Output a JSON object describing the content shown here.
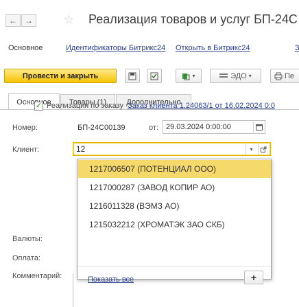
{
  "header": {
    "back_glyph": "←",
    "forward_glyph": "→",
    "favorite_glyph": "☆",
    "title": "Реализация товаров и услуг БП-24С"
  },
  "topnav": {
    "items": [
      "Основное",
      "Идентификаторы Битрикс24",
      "Открыть в Битрикс24",
      "З"
    ]
  },
  "toolbar": {
    "post_close": "Провести и закрыть",
    "edo": "ЭДО",
    "print_partial": "Пе"
  },
  "tabs": [
    "Основное",
    "Товары (1)",
    "Дополнительно"
  ],
  "form": {
    "sale_by_order_label": "Реализация по заказу",
    "order_link": "Заказ клиента 1.24063/1 от 16.02.2024 0:0",
    "number_label": "Номер:",
    "number_value": "БП-24С00139",
    "from_label": "от:",
    "date_value": "29.03.2024  0:00:00",
    "client_label": "Клиент:",
    "client_input": "12",
    "currency_label": "Валюты:",
    "payment_label": "Оплата:",
    "comment_label": "Комментарий:"
  },
  "dropdown": {
    "items": [
      "1217006507 (ПОТЕНЦИАЛ ООО)",
      "1217000287 (ЗАВОД КОПИР АО)",
      "1216011328 (ВЭМЗ АО)",
      "1215032212 (ХРОМАТЭК ЗАО СКБ)"
    ],
    "show_all": "Показать все",
    "add_glyph": "+"
  },
  "colors": {
    "primary_button": "#f6c400",
    "selected_item": "#f6d96b",
    "link": "#2a3f8f"
  }
}
